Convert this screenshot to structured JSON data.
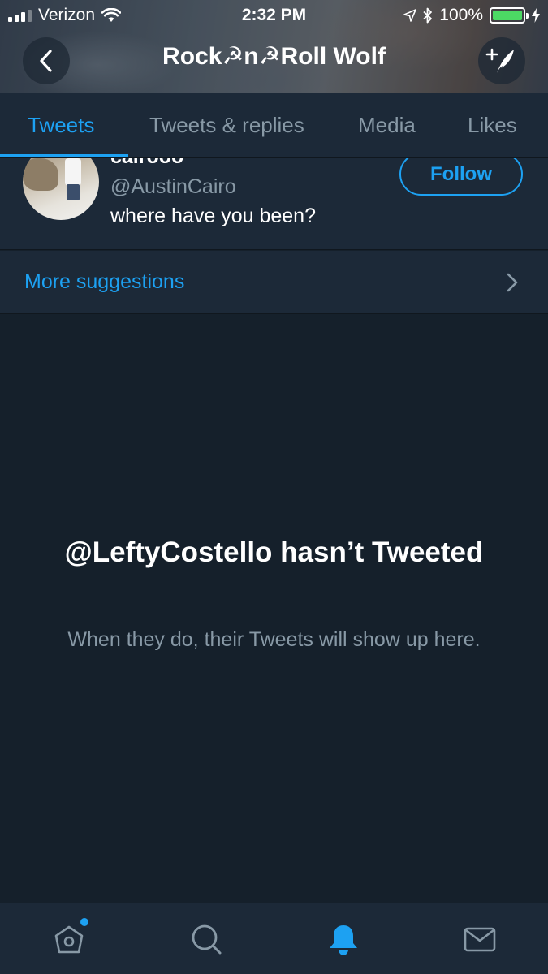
{
  "status_bar": {
    "carrier": "Verizon",
    "time": "2:32 PM",
    "battery": "100%"
  },
  "header": {
    "title": "Rock☭n☭Roll Wolf"
  },
  "tabs": [
    {
      "label": "Tweets",
      "active": true
    },
    {
      "label": "Tweets & replies",
      "active": false
    },
    {
      "label": "Media",
      "active": false
    },
    {
      "label": "Likes",
      "active": false
    }
  ],
  "suggestion": {
    "name": "cairooo",
    "handle": "@AustinCairo",
    "text": "where have you been?",
    "follow_label": "Follow"
  },
  "more_suggestions": {
    "label": "More suggestions"
  },
  "empty_state": {
    "title": "@LeftyCostello hasn’t Tweeted",
    "subtitle": "When they do, their Tweets will show up here."
  },
  "tab_bar": [
    {
      "icon": "home-icon",
      "badge_dot": true
    },
    {
      "icon": "search-icon",
      "badge_dot": false
    },
    {
      "icon": "notifications-bell-icon",
      "active": true
    },
    {
      "icon": "messages-envelope-icon",
      "badge_dot": false
    }
  ],
  "colors": {
    "accent": "#1da1f2",
    "background": "#15202b",
    "surface": "#1c2938",
    "secondary_text": "#8899a6"
  }
}
